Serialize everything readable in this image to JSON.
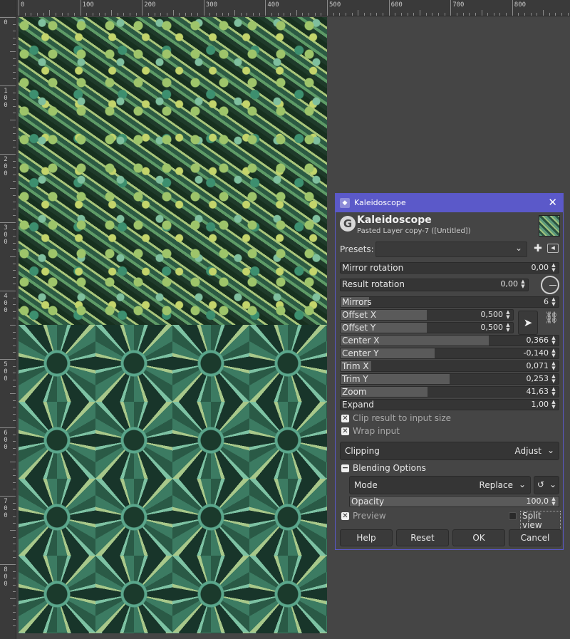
{
  "ruler": {
    "top_labels": [
      "0",
      "100",
      "200",
      "300",
      "400",
      "500",
      "600",
      "700",
      "800"
    ],
    "left_labels": [
      "0",
      "1\n0\n0",
      "2\n0\n0",
      "3\n0\n0",
      "4\n0\n0",
      "5\n0\n0",
      "6\n0\n0",
      "7\n0\n0",
      "8\n0\n0"
    ]
  },
  "dialog": {
    "window_title": "Kaleidoscope",
    "close_glyph": "✕",
    "logo_glyph": "G",
    "header_title": "Kaleidoscope",
    "header_subtitle": "Pasted Layer copy-7 ([Untitled])",
    "presets_label": "Presets:",
    "presets_value": "",
    "params": [
      {
        "label": "Mirror rotation",
        "value": "0,00",
        "fill": 0.0
      },
      {
        "label": "Result rotation",
        "value": "0,00",
        "fill": 0.0
      },
      {
        "label": "Mirrors",
        "value": "6",
        "fill": 0.13
      },
      {
        "label": "Offset X",
        "value": "0,500",
        "fill": 0.5
      },
      {
        "label": "Offset Y",
        "value": "0,500",
        "fill": 0.5
      },
      {
        "label": "Center X",
        "value": "0,366",
        "fill": 0.68
      },
      {
        "label": "Center Y",
        "value": "-0,140",
        "fill": 0.43
      },
      {
        "label": "Trim X",
        "value": "0,071",
        "fill": 0.14
      },
      {
        "label": "Trim Y",
        "value": "0,253",
        "fill": 0.5
      },
      {
        "label": "Zoom",
        "value": "41,63",
        "fill": 0.4
      },
      {
        "label": "Expand",
        "value": "1,00",
        "fill": 0.0
      }
    ],
    "clip_label": "Clip result to input size",
    "wrap_label": "Wrap input",
    "clipping_label": "Clipping",
    "clipping_value": "Adjust",
    "blending_label": "Blending Options",
    "mode_label": "Mode",
    "mode_value": "Replace",
    "opacity_label": "Opacity",
    "opacity_value": "100,0",
    "preview_label": "Preview",
    "split_label": "Split view",
    "buttons": {
      "help": "Help",
      "reset": "Reset",
      "ok": "OK",
      "cancel": "Cancel"
    }
  },
  "colors": {
    "titlebar": "#5b59c9",
    "panel": "#454545"
  }
}
